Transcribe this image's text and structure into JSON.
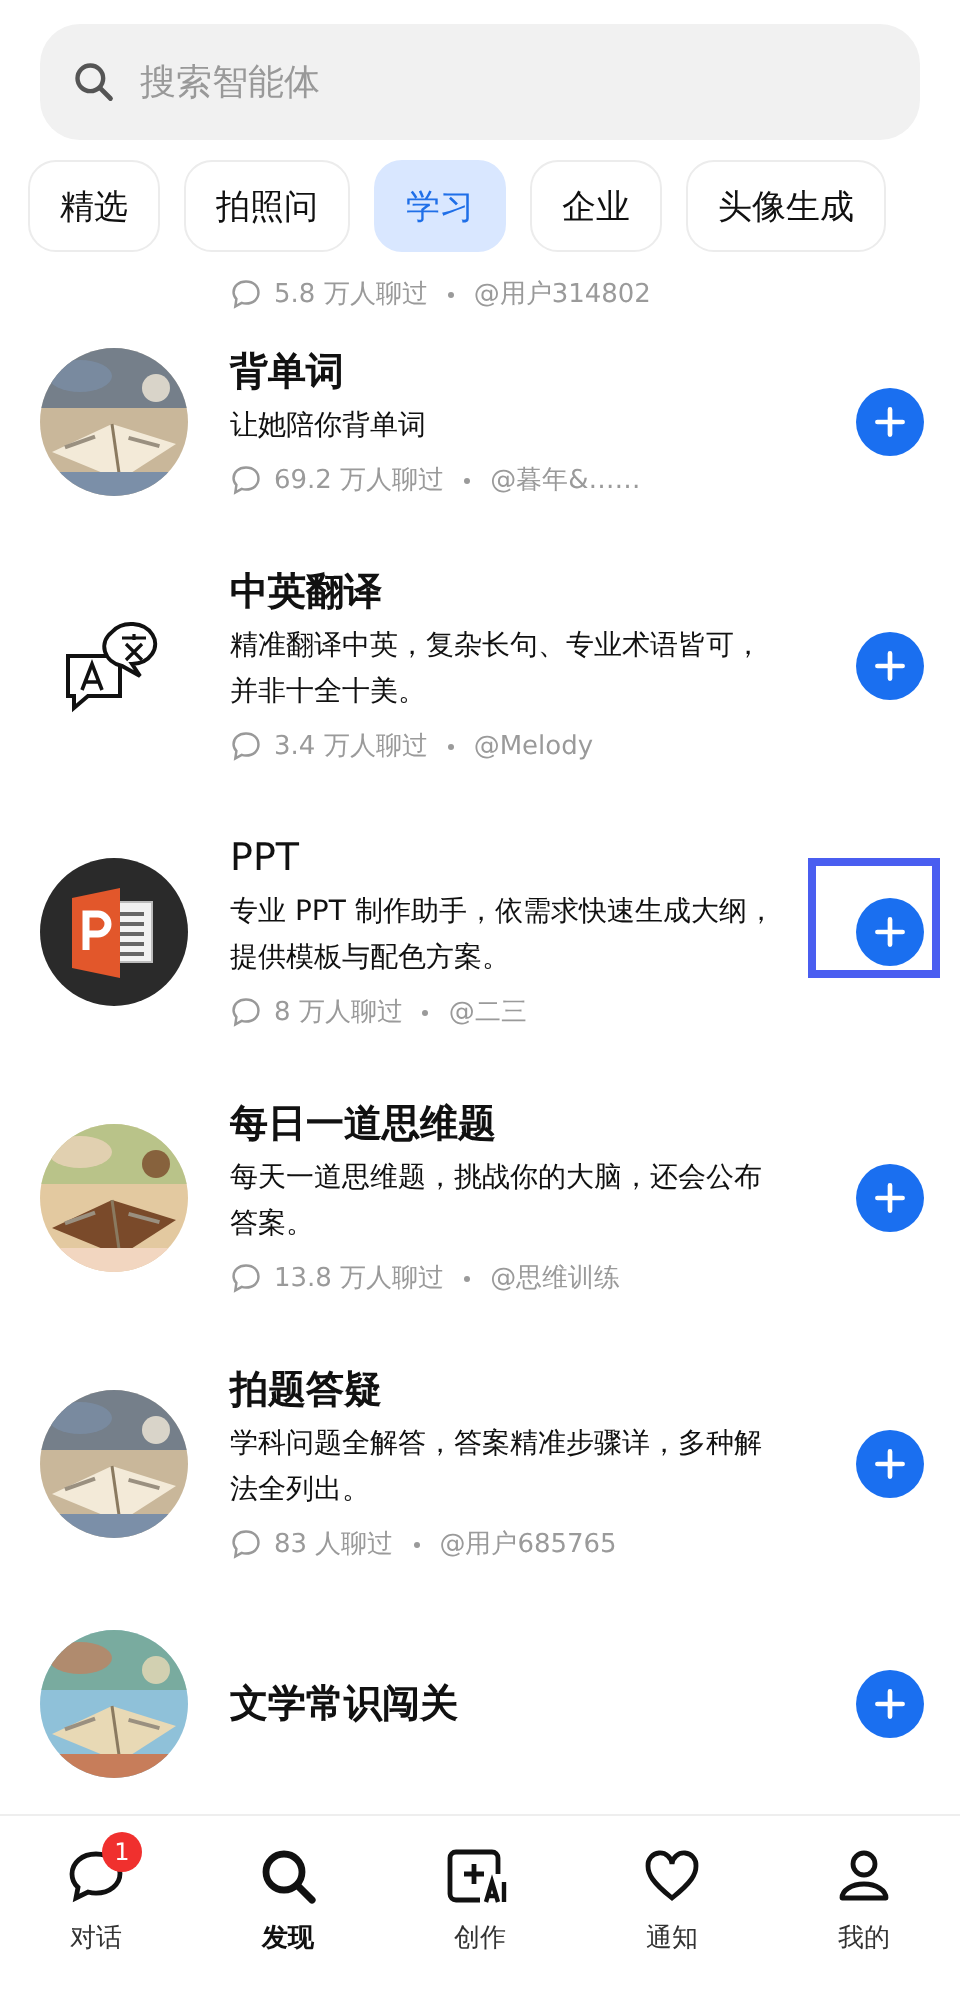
{
  "search": {
    "placeholder": "搜索智能体"
  },
  "categories": [
    {
      "label": "精选",
      "selected": false
    },
    {
      "label": "拍照问",
      "selected": false
    },
    {
      "label": "学习",
      "selected": true
    },
    {
      "label": "企业",
      "selected": false
    },
    {
      "label": "头像生成",
      "selected": false
    }
  ],
  "top_meta": {
    "chats": "5.8 万人聊过",
    "author": "@用户314802"
  },
  "agents": [
    {
      "kind": "picture",
      "name": "背单词",
      "name_bold": true,
      "description": "让她陪你背单词",
      "chats": "69.2 万人聊过",
      "author": "@暮年&……",
      "highlighted": false
    },
    {
      "kind": "translate",
      "name": "中英翻译",
      "name_bold": true,
      "description": "精准翻译中英，复杂长句、专业术语皆可，并非十全十美。",
      "chats": "3.4 万人聊过",
      "author": "@Melody",
      "highlighted": false
    },
    {
      "kind": "ppt",
      "name": "PPT",
      "name_bold": false,
      "description": "专业 PPT 制作助手，依需求快速生成大纲，提供模板与配色方案。",
      "chats": "8 万人聊过",
      "author": "@二三",
      "highlighted": true
    },
    {
      "kind": "picture",
      "name": "每日一道思维题",
      "name_bold": true,
      "description": "每天一道思维题，挑战你的大脑，还会公布答案。",
      "chats": "13.8 万人聊过",
      "author": "@思维训练",
      "highlighted": false
    },
    {
      "kind": "picture",
      "name": "拍题答疑",
      "name_bold": true,
      "description": "学科问题全解答，答案精准步骤详，多种解法全列出。",
      "chats": "83 人聊过",
      "author": "@用户685765",
      "highlighted": false
    },
    {
      "kind": "picture",
      "name": "文学常识闯关",
      "name_bold": true,
      "highlighted": false
    }
  ],
  "nav": [
    {
      "label": "对话",
      "badge": "1",
      "selected": false
    },
    {
      "label": "发现",
      "selected": true
    },
    {
      "label": "创作",
      "selected": false
    },
    {
      "label": "通知",
      "selected": false
    },
    {
      "label": "我的",
      "selected": false
    }
  ]
}
